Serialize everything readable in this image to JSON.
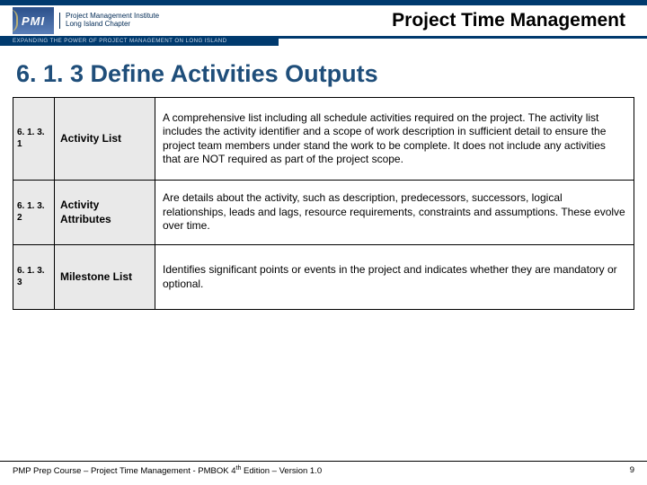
{
  "header": {
    "logo_text": "PMI",
    "org_line1": "Project Management Institute",
    "org_line2": "Long Island Chapter",
    "tagline": "Expanding the Power of Project Management on Long Island",
    "slide_title": "Project Time Management"
  },
  "section_title": "6. 1. 3 Define Activities Outputs",
  "rows": [
    {
      "num": "6. 1. 3. 1",
      "name": "Activity List",
      "desc": "A comprehensive list including all schedule activities required on the project. The activity list includes the activity identifier and a scope of work description in sufficient detail to ensure the project team members under stand the work to be complete. It does not include any activities that are NOT required  as part of the project scope."
    },
    {
      "num": "6. 1. 3. 2",
      "name": "Activity Attributes",
      "desc": "Are details about the activity, such as description, predecessors, successors, logical relationships, leads and lags, resource requirements, constraints and assumptions. These evolve over time."
    },
    {
      "num": "6. 1. 3. 3",
      "name": "Milestone List",
      "desc": "Identifies significant points or events in the project and indicates whether they are mandatory or optional."
    }
  ],
  "footer": {
    "left": "PMP Prep Course – Project Time Management - PMBOK 4th Edition – Version 1.0",
    "right": "9"
  }
}
